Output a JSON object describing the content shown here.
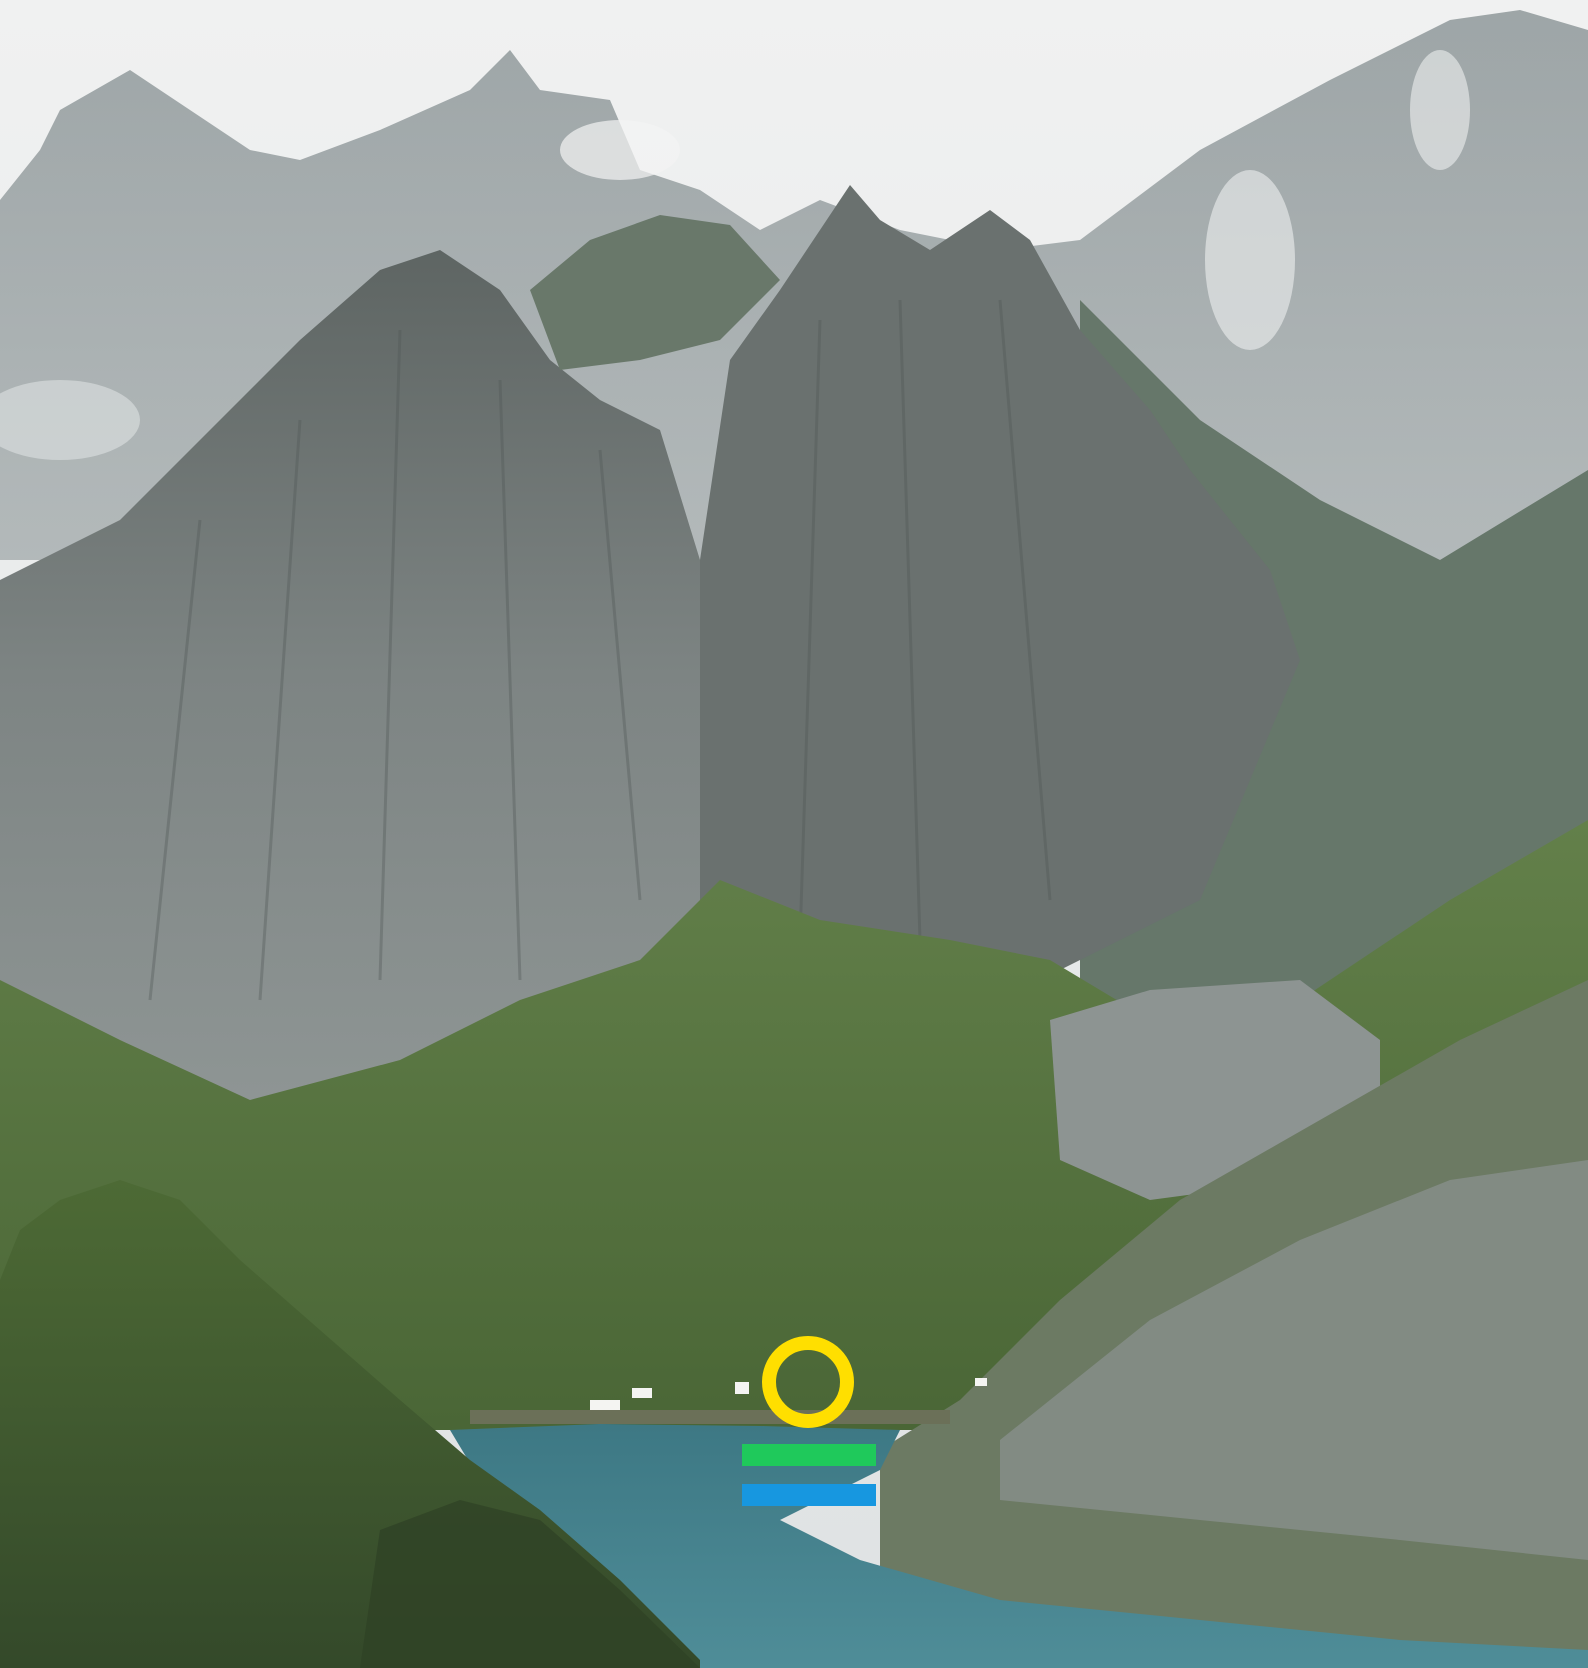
{
  "scene": {
    "description_label": "",
    "colors": {
      "sky": "#e9ebec",
      "far_mountains": "#9aa3a6",
      "rock": "#6f7676",
      "rock_light": "#9ba2a1",
      "grass": "#5d7a45",
      "grass_dark": "#3f5a2f",
      "water": "#3f7f8a",
      "mist": "#f2f3f3"
    }
  },
  "logo": {
    "ring_color": "#ffdf00",
    "bar_top_color": "#1fc95b",
    "bar_bottom_color": "#1797e0"
  }
}
